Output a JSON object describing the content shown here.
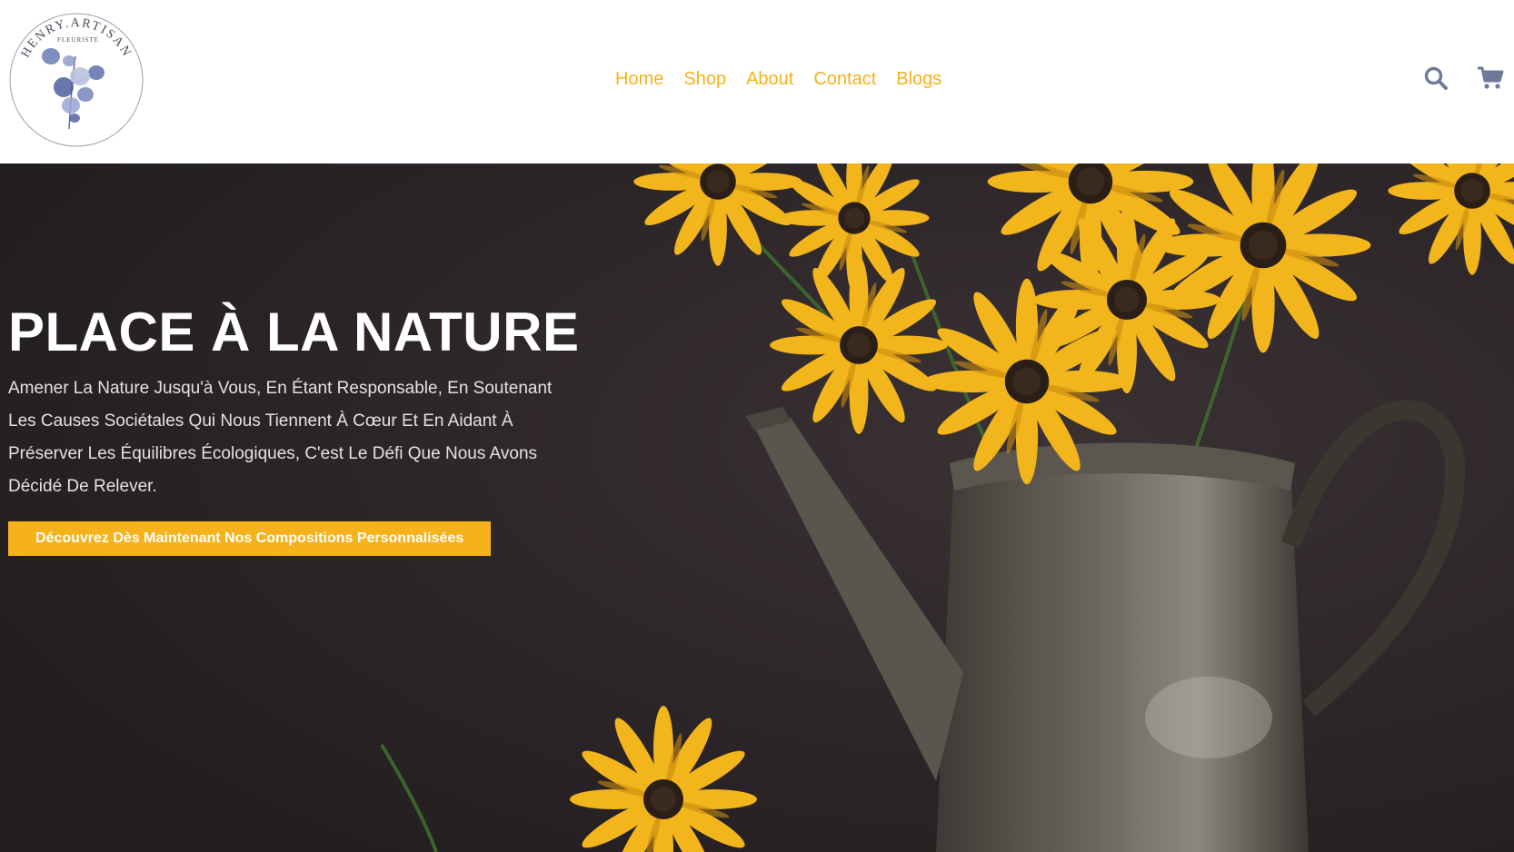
{
  "brand": {
    "logo_text": "HENRY.ARTISAN",
    "logo_subtext": "FLEURISTE"
  },
  "nav": {
    "items": [
      {
        "label": "Home"
      },
      {
        "label": "Shop"
      },
      {
        "label": "About"
      },
      {
        "label": "Contact"
      },
      {
        "label": "Blogs"
      }
    ]
  },
  "header_icons": {
    "search": "search-icon",
    "cart": "cart-icon"
  },
  "hero": {
    "title": "PLACE À LA NATURE",
    "text": "Amener La Nature Jusqu'à Vous, En Étant Responsable, En Soutenant Les Causes Sociétales Qui Nous Tiennent À Cœur Et En Aidant À Préserver Les Équilibres Écologiques, C'est Le Défi Que Nous Avons Décidé De Relever.",
    "cta_label": "Découvrez Dès Maintenant Nos Compositions Personnalisées"
  },
  "colors": {
    "accent": "#f6b21a",
    "icon": "#6f7a9a",
    "hero_bg": "#2b2527"
  }
}
